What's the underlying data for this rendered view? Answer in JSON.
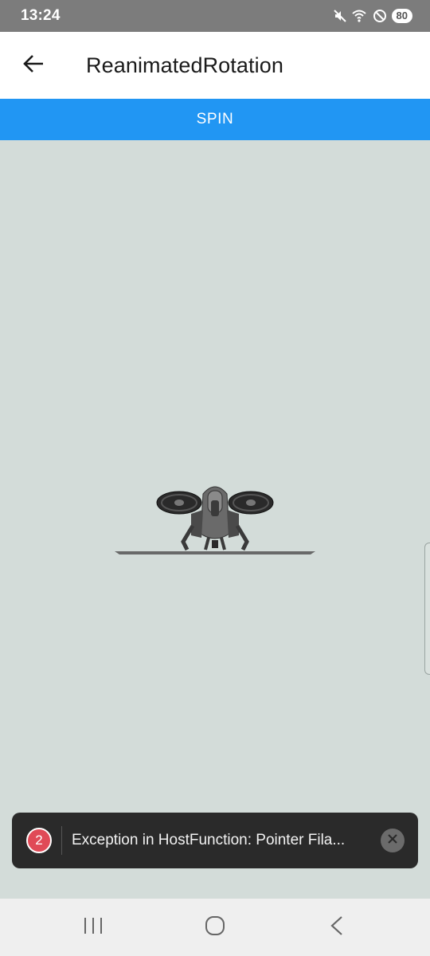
{
  "status_bar": {
    "time": "13:24",
    "battery": "80",
    "icons": [
      "mute-icon",
      "wifi-icon",
      "do-not-disturb-icon",
      "battery-icon"
    ]
  },
  "app_bar": {
    "title": "ReanimatedRotation",
    "back_icon": "arrow-left-icon"
  },
  "spin_button": {
    "label": "SPIN",
    "color": "#2196f3"
  },
  "viewport": {
    "background": "#d3dcd9",
    "content": "drone-3d-model"
  },
  "error_toast": {
    "count": "2",
    "message": "Exception in HostFunction: Pointer Fila...",
    "badge_color": "#e04a57"
  },
  "nav_bar": {
    "buttons": [
      "recent-apps",
      "home",
      "back"
    ]
  }
}
